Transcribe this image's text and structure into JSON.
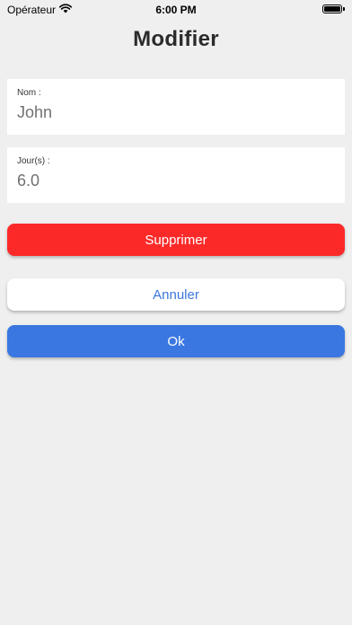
{
  "status_bar": {
    "carrier": "Opérateur",
    "time": "6:00 PM",
    "wifi_icon": "wifi-icon",
    "battery_icon": "battery-icon",
    "battery_level": 1.0
  },
  "header": {
    "title": "Modifier"
  },
  "form": {
    "name_label": "Nom :",
    "name_value": "John",
    "days_label": "Jour(s) :",
    "days_value": "6.0"
  },
  "actions": {
    "delete_label": "Supprimer",
    "cancel_label": "Annuler",
    "ok_label": "Ok"
  },
  "colors": {
    "background": "#efefef",
    "delete": "#fb2a29",
    "primary": "#3a77e0",
    "cancel_text": "#3a77dd"
  }
}
